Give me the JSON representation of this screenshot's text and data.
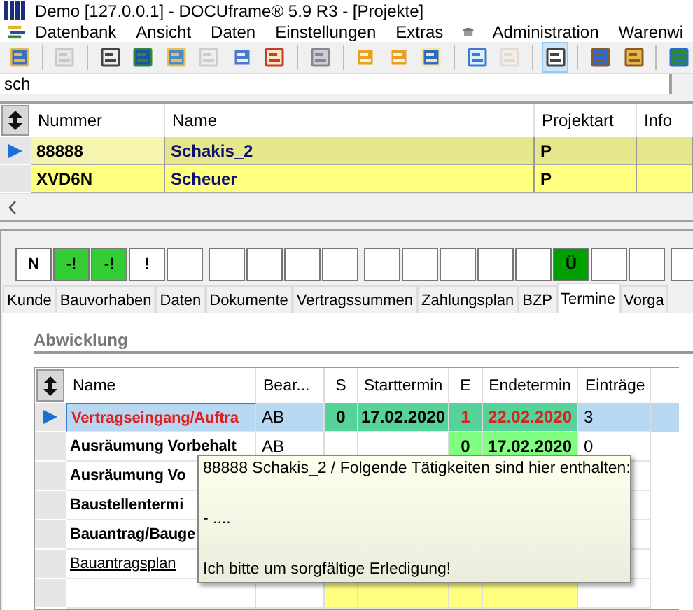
{
  "window": {
    "title": "Demo [127.0.0.1] - DOCUframe® 5.9 R3 - [Projekte]"
  },
  "menu": [
    {
      "label": "Datenbank"
    },
    {
      "label": "Ansicht"
    },
    {
      "label": "Daten"
    },
    {
      "label": "Einstellungen"
    },
    {
      "label": "Extras"
    },
    {
      "label": "Administration",
      "kind": "with-icon"
    },
    {
      "label": "Warenwi"
    }
  ],
  "search": {
    "value": "sch"
  },
  "projects": {
    "columns": [
      "Nummer",
      "Name",
      "Projektart",
      "Info"
    ],
    "rows": [
      {
        "nummer": "88888",
        "name": "Schakis_2",
        "projektart": "P",
        "selected": true
      },
      {
        "nummer": "XVD6N",
        "name": "Scheuer",
        "projektart": "P",
        "selected": false
      }
    ]
  },
  "status_boxes": [
    [
      {
        "kind": "text",
        "text": "N"
      },
      {
        "kind": "text",
        "text": "-!",
        "color": "#33cc33"
      },
      {
        "kind": "text",
        "text": "-!",
        "color": "#33cc33"
      },
      {
        "kind": "text",
        "text": "!"
      },
      {
        "kind": "blank"
      }
    ],
    [
      {
        "kind": "blank"
      },
      {
        "kind": "blank"
      },
      {
        "kind": "blank"
      },
      {
        "kind": "blank"
      }
    ],
    [
      {
        "kind": "blank"
      },
      {
        "kind": "blank"
      },
      {
        "kind": "blank"
      },
      {
        "kind": "blank"
      },
      {
        "kind": "blank"
      },
      {
        "kind": "text",
        "text": "Ü",
        "color": "#00a000"
      },
      {
        "kind": "blank"
      },
      {
        "kind": "blank"
      }
    ],
    [
      {
        "kind": "blank"
      }
    ]
  ],
  "tabs": [
    {
      "label": "Kunde",
      "selected": false
    },
    {
      "label": "Bauvorhaben",
      "selected": false
    },
    {
      "label": "Daten",
      "selected": false
    },
    {
      "label": "Dokumente",
      "selected": false
    },
    {
      "label": "Vertragssummen",
      "selected": false
    },
    {
      "label": "Zahlungsplan",
      "selected": false
    },
    {
      "label": "BZP",
      "selected": false
    },
    {
      "label": "Termine",
      "selected": true
    },
    {
      "label": "Vorga",
      "selected": false
    }
  ],
  "section": {
    "title": "Abwicklung"
  },
  "tasks": {
    "columns": [
      "Name",
      "Bear...",
      "S",
      "Starttermin",
      "E",
      "Endetermin",
      "Einträge"
    ],
    "rows": [
      {
        "selected": true,
        "cells": [
          {
            "text": "Vertragseingang/Auftra",
            "kind": "alert"
          },
          "AB",
          {
            "text": "0",
            "color": "#55d39a",
            "alert": false
          },
          {
            "text": "17.02.2020",
            "color": "#55d39a",
            "alert": false
          },
          {
            "text": "1",
            "color": "#55d39a",
            "alert": true
          },
          {
            "text": "22.02.2020",
            "color": "#55d39a",
            "alert": true
          },
          "3"
        ]
      },
      {
        "selected": false,
        "cells": [
          {
            "text": "Ausräumung Vorbehalt",
            "kind": "bold"
          },
          "AB",
          "",
          "",
          {
            "text": "0",
            "color": "#80ff80",
            "alert": false
          },
          {
            "text": "17.02.2020",
            "color": "#80ff80",
            "alert": false
          },
          "0"
        ]
      },
      {
        "selected": false,
        "cells": [
          {
            "text": "Ausräumung Vo",
            "kind": "bold"
          }
        ]
      },
      {
        "selected": false,
        "cells": [
          {
            "text": "Baustellentermi",
            "kind": "bold"
          }
        ]
      },
      {
        "selected": false,
        "cells": [
          {
            "text": "Bauantrag/Bauge",
            "kind": "bold"
          }
        ]
      },
      {
        "selected": false,
        "cells": [
          {
            "text": "Bauantragsplan",
            "kind": "link"
          }
        ]
      },
      {
        "selected": false,
        "cells": [
          "",
          "",
          {
            "color": "#ffff80"
          },
          {
            "color": "#ffff80"
          },
          {
            "color": "#ffff80"
          },
          {
            "color": "#ffff80"
          }
        ]
      }
    ]
  },
  "tooltip": {
    "lines": [
      "88888 Schakis_2 / Folgende Tätigkeiten sind hier enthalten:",
      "- ....",
      "Ich bitte um sorgfältige Erledigung!"
    ]
  }
}
